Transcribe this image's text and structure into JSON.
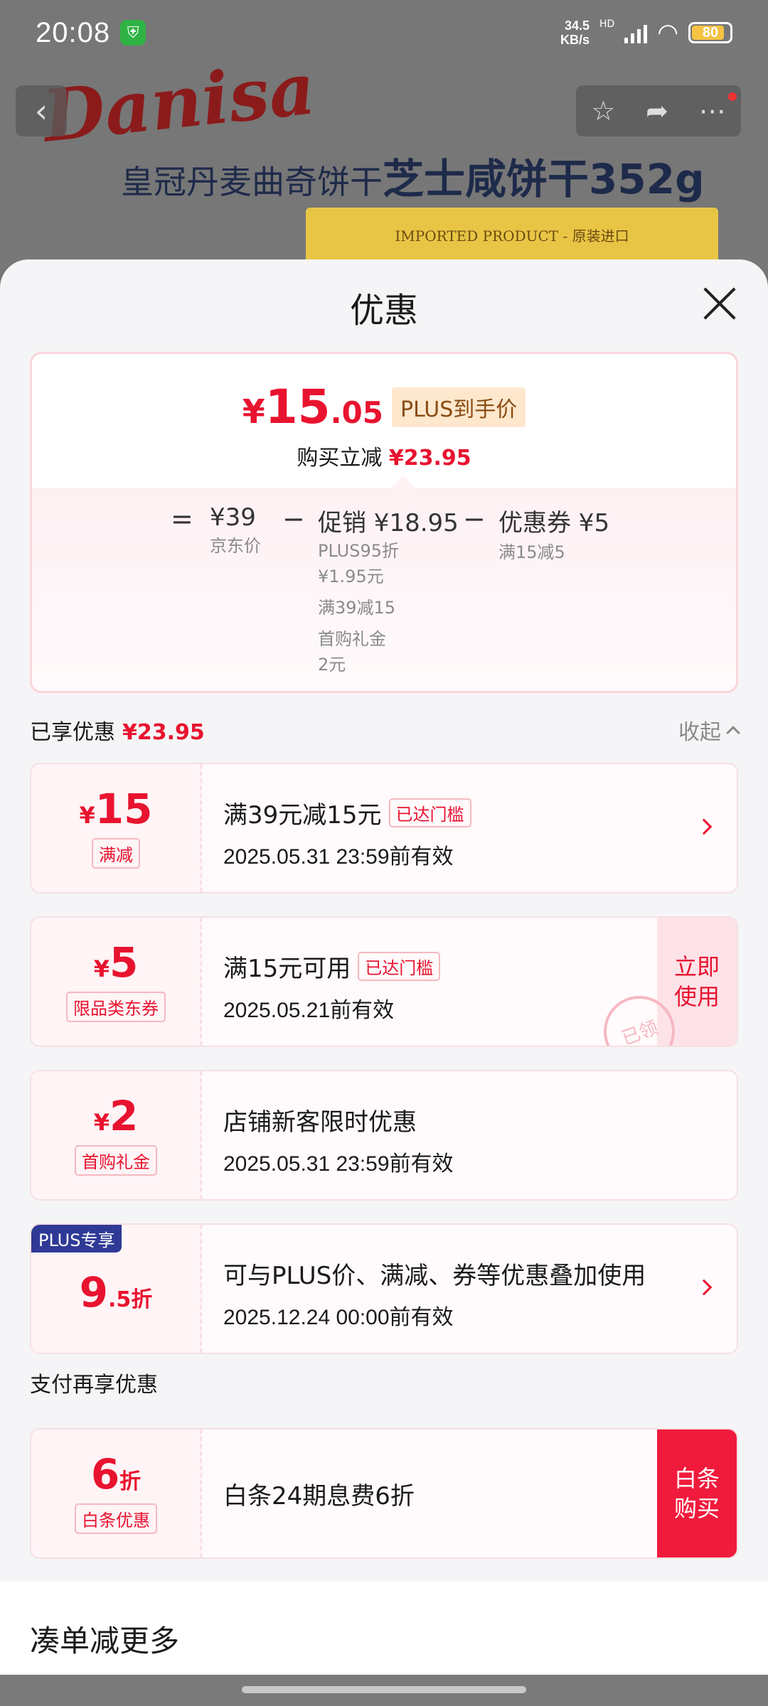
{
  "status_bar": {
    "time": "20:08",
    "net_speed_value": "34.5",
    "net_speed_unit": "KB/s",
    "network_badge": "HD",
    "battery": "80"
  },
  "product": {
    "brand": "Danisa",
    "title_prefix": "皇冠丹麦曲奇饼干",
    "title_main": "芝士咸饼干352g",
    "box_text": "IMPORTED PRODUCT - 原装进口"
  },
  "sheet": {
    "title": "优惠"
  },
  "summary": {
    "price_symbol": "¥",
    "price_integer": "15",
    "price_decimal": ".05",
    "price_tag": "PLUS到手价",
    "saving_label": "购买立减",
    "saving_value": "¥23.95",
    "formula": {
      "eq": "=",
      "minus1": "−",
      "minus2": "−",
      "jd_price": "¥39",
      "jd_price_label": "京东价",
      "promo": "促销 ¥18.95",
      "promo_items": [
        "PLUS95折",
        "¥1.95元",
        "满39减15",
        "首购礼金",
        "2元"
      ],
      "coupon": "优惠券 ¥5",
      "coupon_label": "满15减5"
    }
  },
  "enjoyed": {
    "label": "已享优惠",
    "value": "¥23.95",
    "collapse": "收起"
  },
  "offers": [
    {
      "symbol": "¥",
      "amount": "15",
      "tag": "满减",
      "title": "满39元减15元",
      "badge": "已达门槛",
      "date": "2025.05.31 23:59前有效"
    },
    {
      "symbol": "¥",
      "amount": "5",
      "tag": "限品类东券",
      "title": "满15元可用",
      "badge": "已达门槛",
      "date": "2025.05.21前有效",
      "action": "立即使用",
      "stamp": "已领"
    },
    {
      "symbol": "¥",
      "amount": "2",
      "tag": "首购礼金",
      "title": "店铺新客限时优惠",
      "date": "2025.05.31 23:59前有效"
    },
    {
      "corner": "PLUS专享",
      "amount": "9",
      "decimal": ".5",
      "unit": "折",
      "title": "可与PLUS价、满减、券等优惠叠加使用",
      "date": "2025.12.24 00:00前有效"
    }
  ],
  "payment": {
    "label": "支付再享优惠",
    "amount": "6",
    "unit": "折",
    "tag": "白条优惠",
    "title": "白条24期息费6折",
    "action": "白条购买"
  },
  "more": {
    "title": "凑单减更多"
  },
  "colors": {
    "accent": "#e8132f",
    "plus_blue": "#2f3a96",
    "plus_tag_bg": "#fde8cd"
  }
}
